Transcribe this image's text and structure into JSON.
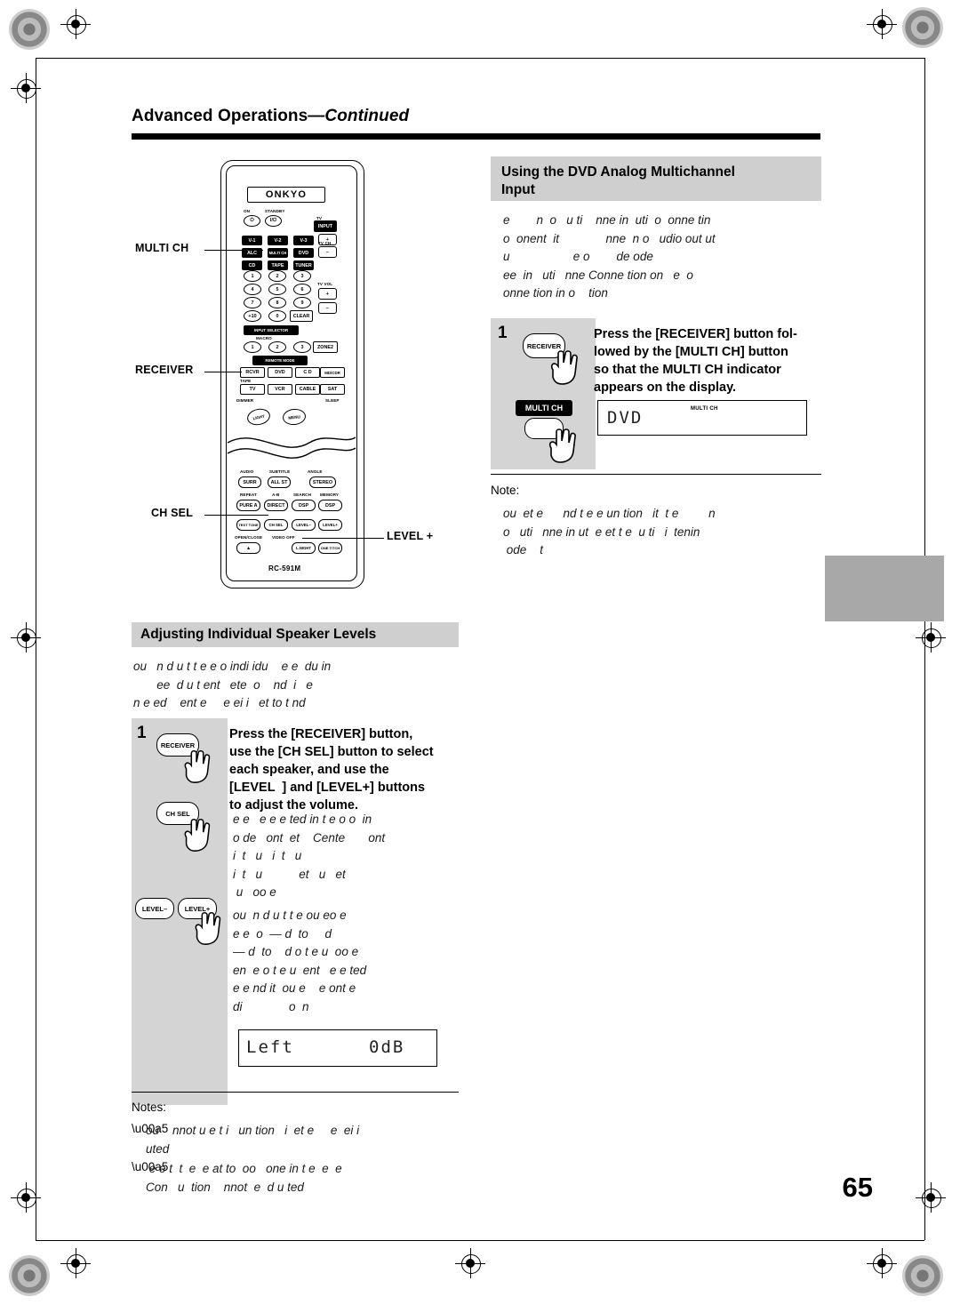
{
  "page": {
    "header_title_main": "Advanced Operations",
    "header_title_cont": "—Continued",
    "page_number": "65"
  },
  "sections": {
    "dvd": {
      "title_line1": "Using the DVD Analog Multichannel",
      "title_line2": "Input",
      "intro": "e        n  o   u ti    nne in  uti  o  onne tin\no  onent  it              nne  n o   udio out ut\nu                   e o        de ode\nee  in   uti   nne Conne tion on   e  o\nonne tion in o    tion"
    },
    "speaker": {
      "title": "Adjusting Individual Speaker Levels",
      "intro": "ou   n d u t t e e o indi idu    e e  du in\n       ee  d u t ent   ete  o    nd  i   e\nn e ed    ent e     e ei i   et to t nd"
    }
  },
  "steps": {
    "dvd_step": {
      "number": "1",
      "text": "Press the [RECEIVER] button fol-\nlowed by the [MULTI CH] button\nso that the MULTI CH indicator\nappears on the display.",
      "button_receiver": "RECEIVER",
      "button_multich": "MULTI CH",
      "display_text": "DVD",
      "display_indicator": "MULTI CH"
    },
    "speaker_step": {
      "number": "1",
      "text": "Press the [RECEIVER] button,\nuse the [CH SEL] button to select\neach speaker, and use the\n[LEVEL  ] and [LEVEL+] buttons\nto adjust the volume.",
      "button_receiver": "RECEIVER",
      "button_chsel": "CH SEL",
      "button_level_minus": "LEVEL–",
      "button_level_plus": "LEVEL+",
      "body_1": "e e   e e e ted in t e o o  in\no de   ont  et    Cente       ont\ni  t   u   i  t   u\ni  t   u           et   u   et\n u   oo e",
      "body_2": "ou  n d u t t e ou eo e\ne e  o  — d  to     d\n— d  to    d o t e u  oo e\nen  e o t e u  ent   e e ted\ne e nd it  ou e    e ont e\ndi              o  n",
      "display_left": "Left",
      "display_level": "0dB"
    }
  },
  "notes": {
    "dvd_note_label": "Note:",
    "dvd_note_text": "ou  et e      nd t e e un tion   it  t e         n\no   uti   nne in ut  e et t e  u ti   i  tenin\n ode    t",
    "speaker_notes_label": "Notes:",
    "speaker_note_1": "ou    nnot u e t i   un tion   i  et e     e  ei i\nuted",
    "speaker_note_2": " e e t  t  e  e at to  oo   one in t e  e  e\nCon   u  tion    nnot  e  d u ted"
  },
  "callouts": {
    "multich": "MULTI CH",
    "receiver": "RECEIVER",
    "chsel": "CH SEL",
    "level": "LEVEL  +"
  },
  "remote": {
    "brand": "ONKYO",
    "model": "RC-591M",
    "labels": {
      "on": "ON",
      "standby": "STANDBY",
      "tv": "TV",
      "input_selector": "INPUT SELECTOR",
      "macro": "MACRO",
      "remote_mode": "REMOTE MODE",
      "tape": "TAPE",
      "dimmer": "DIMMER",
      "sleep": "SLEEP",
      "tv_ch": "TV CH",
      "tv_vol": "TV VOL",
      "audio": "AUDIO",
      "subtitle": "SUBTITLE",
      "angle": "ANGLE",
      "repeat": "REPEAT",
      "ab": "A-B",
      "search": "SEARCH",
      "memory": "MEMORY",
      "open_close": "OPEN/CLOSE",
      "video_off": "VIDEO OFF"
    },
    "keys": {
      "power": "⏻",
      "onoff": "I/⏻",
      "input": "INPUT",
      "v1": "V-1",
      "v2": "V-2",
      "v3": "V-3",
      "alc": "ALC",
      "multich": "MULTI CH",
      "dvd": "DVD",
      "cd": "CD",
      "tape2": "TAPE",
      "tuner": "TUNER",
      "clear": "CLEAR",
      "plus10": "+10",
      "zone2": "ZONE2",
      "rcvr": "RCVR",
      "dvd2": "DVD",
      "cdr": "C D",
      "mdcdr": "MD/CDR",
      "tv2": "TV",
      "vcr": "VCR",
      "cable": "CABLE",
      "sat": "SAT",
      "light": "LIGHT",
      "menu": "MENU",
      "surr": "SURR",
      "allst": "ALL ST",
      "stereo": "STEREO",
      "purea": "PURE A",
      "direct": "DIRECT",
      "dsp": "DSP",
      "dspplus": "DSP",
      "testtone": "TEST TONE",
      "chsel": "CH SEL",
      "levelminus": "LEVEL–",
      "levelplus": "LEVEL+",
      "lnight": "L.NIGHT",
      "onetouch": "ONE T/TCH",
      "n1": "1",
      "n2": "2",
      "n3": "3",
      "n4": "4",
      "n5": "5",
      "n6": "6",
      "n7": "7",
      "n8": "8",
      "n9": "9",
      "n0": "0",
      "m1": "1",
      "m2": "2",
      "m3": "3",
      "up": "+",
      "dn": "–",
      "vup": "+",
      "vdn": "–",
      "eject": "▲"
    }
  }
}
